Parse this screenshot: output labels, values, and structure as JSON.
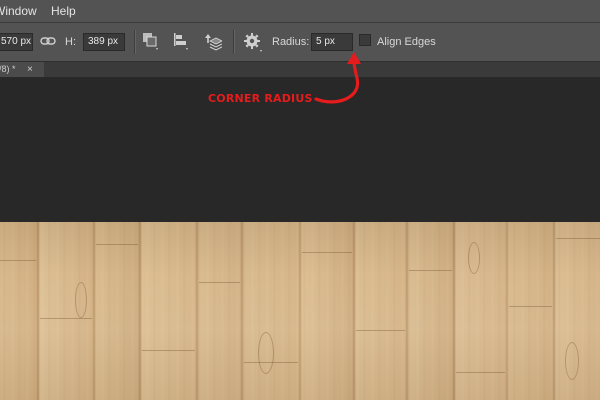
{
  "menu": {
    "window_label": "Window",
    "help_label": "Help"
  },
  "options": {
    "width_value": "570 px",
    "height_label": "H:",
    "height_value": "389 px",
    "radius_label": "Radius:",
    "radius_value": "5 px",
    "align_edges_label": "Align Edges",
    "align_edges_checked": false,
    "icons": [
      "link-icon",
      "path-operations-icon",
      "path-alignment-icon",
      "path-arrangement-icon",
      "gear-icon"
    ]
  },
  "document_tab": {
    "title_fragment": "/8) *",
    "close_glyph": "×"
  },
  "annotation": {
    "text": "CORNER RADIUS",
    "color": "#e61c1c"
  },
  "colors": {
    "panel": "#535353",
    "workspace": "#282828",
    "wood": "#d4b387"
  }
}
